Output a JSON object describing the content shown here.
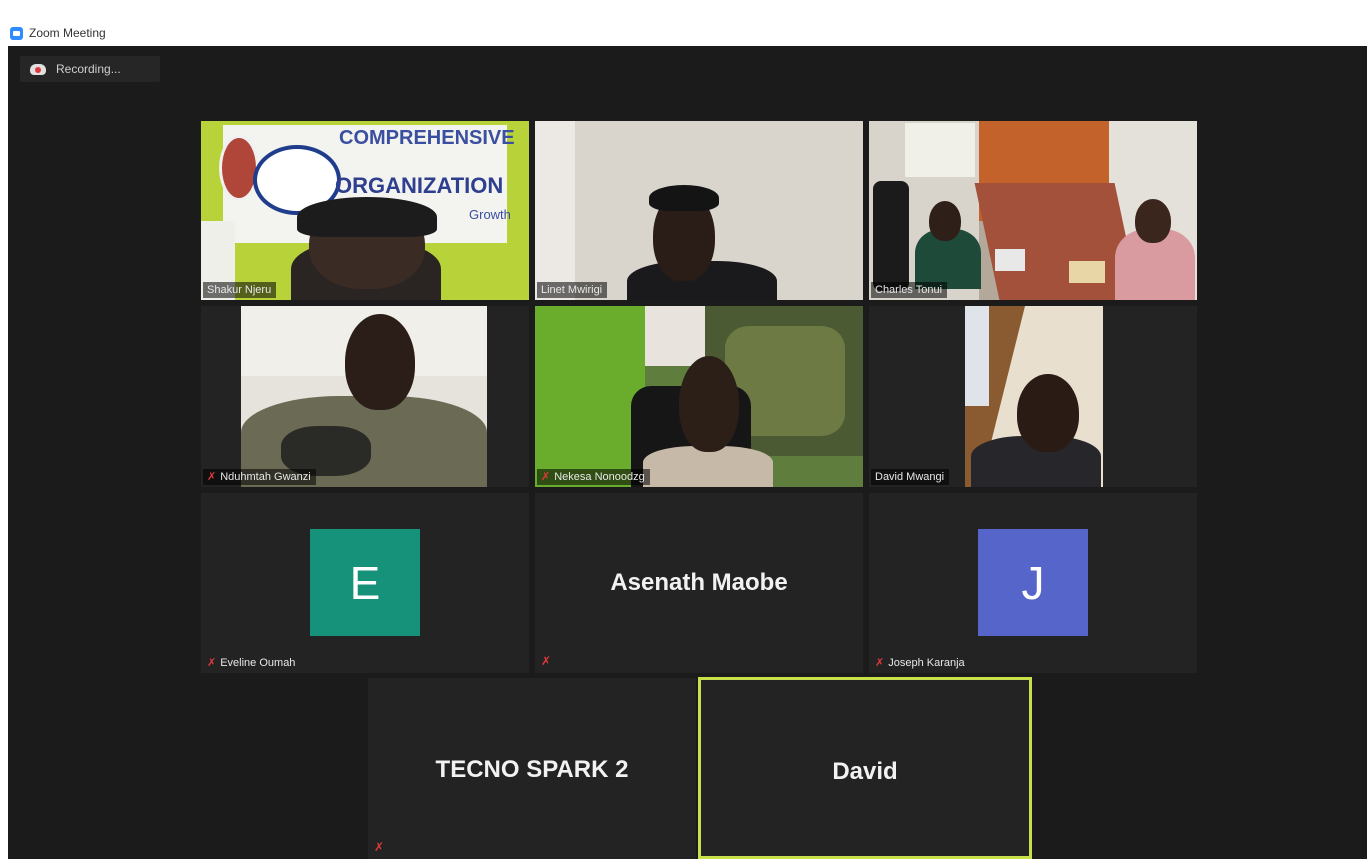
{
  "window": {
    "title": "Zoom Meeting"
  },
  "recording": {
    "label": "Recording..."
  },
  "participants": [
    {
      "name": "Shakur Njeru",
      "muted": false
    },
    {
      "name": "Linet Mwirigi",
      "muted": false
    },
    {
      "name": "Charles Tonui",
      "muted": false
    },
    {
      "name": "Nduhmtah Gwanzi",
      "muted": true
    },
    {
      "name": "Nekesa Nonoodzg",
      "muted": true
    },
    {
      "name": "David Mwangi",
      "muted": false
    },
    {
      "name": "Eveline Oumah",
      "muted": true,
      "avatar_letter": "E",
      "avatar_color": "#16927a"
    },
    {
      "name": "Asenath Maobe",
      "muted": true
    },
    {
      "name": "Joseph Karanja",
      "muted": true,
      "avatar_letter": "J",
      "avatar_color": "#5665c9"
    },
    {
      "name": "TECNO SPARK 2",
      "muted": true
    },
    {
      "name": "David",
      "muted": false,
      "active_speaker": true
    }
  ],
  "banner": {
    "line1": "COMPREHENSIVE",
    "line2": "ORGANIZATION",
    "line3": "Growth"
  },
  "colors": {
    "meeting_bg": "#1b1b1b",
    "tile_bg": "#232323",
    "active_speaker_border": "#c9e04a",
    "muted_red": "#e0383e"
  }
}
